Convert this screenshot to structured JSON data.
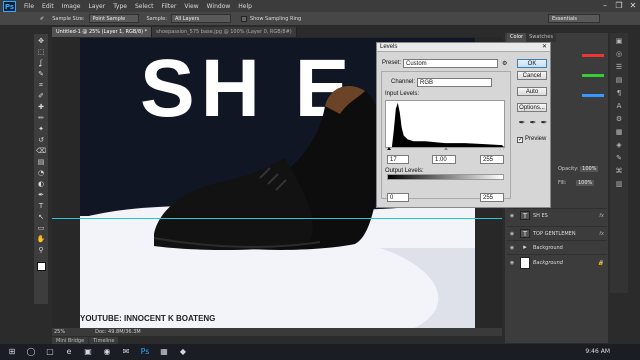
{
  "app": {
    "logo": "Ps"
  },
  "menu": [
    "File",
    "Edit",
    "Image",
    "Layer",
    "Type",
    "Select",
    "Filter",
    "View",
    "Window",
    "Help"
  ],
  "window_controls": {
    "minimize": "–",
    "restore": "❐",
    "close": "✕"
  },
  "options": {
    "sample_size_label": "Sample Size:",
    "sample_size_value": "Point Sample",
    "sample_label": "Sample:",
    "sample_value": "All Layers",
    "show_ring": "Show Sampling Ring",
    "workspace": "Essentials"
  },
  "tabs": [
    "Untitled-1 @ 25% (Layer 1, RGB/8) *",
    "shoepassion_575 base.jpg @ 100% (Layer 0, RGB/8#)"
  ],
  "toolbar_icons": [
    "move-icon",
    "marquee-icon",
    "lasso-icon",
    "quick-select-icon",
    "crop-icon",
    "eyedropper-icon",
    "healing-icon",
    "brush-icon",
    "clone-icon",
    "history-brush-icon",
    "eraser-icon",
    "gradient-icon",
    "blur-icon",
    "dodge-icon",
    "pen-icon",
    "type-icon",
    "path-select-icon",
    "shape-icon",
    "hand-icon",
    "zoom-icon"
  ],
  "toolbar_glyphs": [
    "✥",
    "⬚",
    "ʆ",
    "✎",
    "⌗",
    "✐",
    "✚",
    "✏",
    "✦",
    "↺",
    "⌫",
    "▤",
    "◔",
    "◐",
    "✒",
    "T",
    "↖",
    "▭",
    "✋",
    "⚲"
  ],
  "canvas": {
    "big_text": "SH      E",
    "footer_text": "YOUTUBE: INNOCENT K BOATENG"
  },
  "status": {
    "zoom": "25%",
    "doc": "Doc: 49.8M/36.3M"
  },
  "bottom_tabs": [
    "Mini Bridge",
    "Timeline"
  ],
  "levels": {
    "title": "Levels",
    "preset_label": "Preset:",
    "preset_value": "Custom",
    "channel_label": "Channel:",
    "channel_value": "RGB",
    "input_label": "Input Levels:",
    "input_black": "17",
    "input_gamma": "1.00",
    "input_white": "255",
    "output_label": "Output Levels:",
    "output_black": "0",
    "output_white": "255",
    "ok": "OK",
    "cancel": "Cancel",
    "auto": "Auto",
    "options": "Options...",
    "preview": "Preview",
    "close": "✕"
  },
  "panels": {
    "color_tab": "Color",
    "swatches_tab": "Swatches",
    "opacity_label": "Opacity:",
    "opacity_value": "100%",
    "fill_label": "Fill:",
    "fill_value": "100%",
    "layers": [
      {
        "name": "SH    ES",
        "thumb": "T",
        "fx": "fx"
      },
      {
        "name": "TOP GENTLEMEN",
        "thumb": "T",
        "fx": "fx"
      },
      {
        "name": "Background",
        "thumb": "▸",
        "fx": ""
      },
      {
        "name": "Background",
        "thumb": "",
        "fx": ""
      }
    ]
  },
  "right_icons": [
    "▣",
    "◎",
    "☰",
    "▤",
    "¶",
    "A",
    "⚙",
    "▦",
    "◈",
    "✎",
    "⌘",
    "▥"
  ],
  "taskbar": {
    "icons": [
      "⊞",
      "◯",
      "▢",
      "e",
      "▣",
      "◉",
      "✉",
      "Ps",
      "▦",
      "◆"
    ],
    "time": "9:46 AM"
  }
}
